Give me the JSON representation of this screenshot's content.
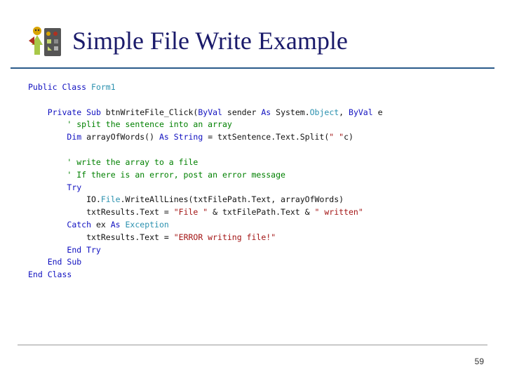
{
  "slide": {
    "title": "Simple File Write Example",
    "page_number": "59"
  },
  "code": {
    "l0_kw": "Public Class",
    "l0_type": " Form1",
    "l1_kw1": "Private Sub",
    "l1_txt1": " btnWriteFile_Click(",
    "l1_kw2": "ByVal",
    "l1_txt2": " sender ",
    "l1_kw3": "As",
    "l1_txt3": " System.",
    "l1_type1": "Object",
    "l1_txt4": ", ",
    "l1_kw4": "ByVal",
    "l1_txt5": " e",
    "l2_cmt": "' split the sentence into an array",
    "l3_kw1": "Dim",
    "l3_txt1": " arrayOfWords() ",
    "l3_kw2": "As String",
    "l3_txt2": " = txtSentence.Text.Split(",
    "l3_str": "\" \"",
    "l3_txt3": "c)",
    "l4_cmt": "' write the array to a file",
    "l5_cmt": "' If there is an error, post an error message",
    "l6_kw": "Try",
    "l7_txt1": "IO.",
    "l7_type": "File",
    "l7_txt2": ".WriteAllLines(txtFilePath.Text, arrayOfWords)",
    "l8_txt1": "txtResults.Text = ",
    "l8_str1": "\"File \"",
    "l8_txt2": " & txtFilePath.Text & ",
    "l8_str2": "\" written\"",
    "l9_kw1": "Catch",
    "l9_txt1": " ex ",
    "l9_kw2": "As",
    "l9_type": " Exception",
    "l10_txt1": "txtResults.Text = ",
    "l10_str": "\"ERROR writing file!\"",
    "l11_kw": "End Try",
    "l12_kw": "End Sub",
    "l13_kw": "End Class"
  }
}
